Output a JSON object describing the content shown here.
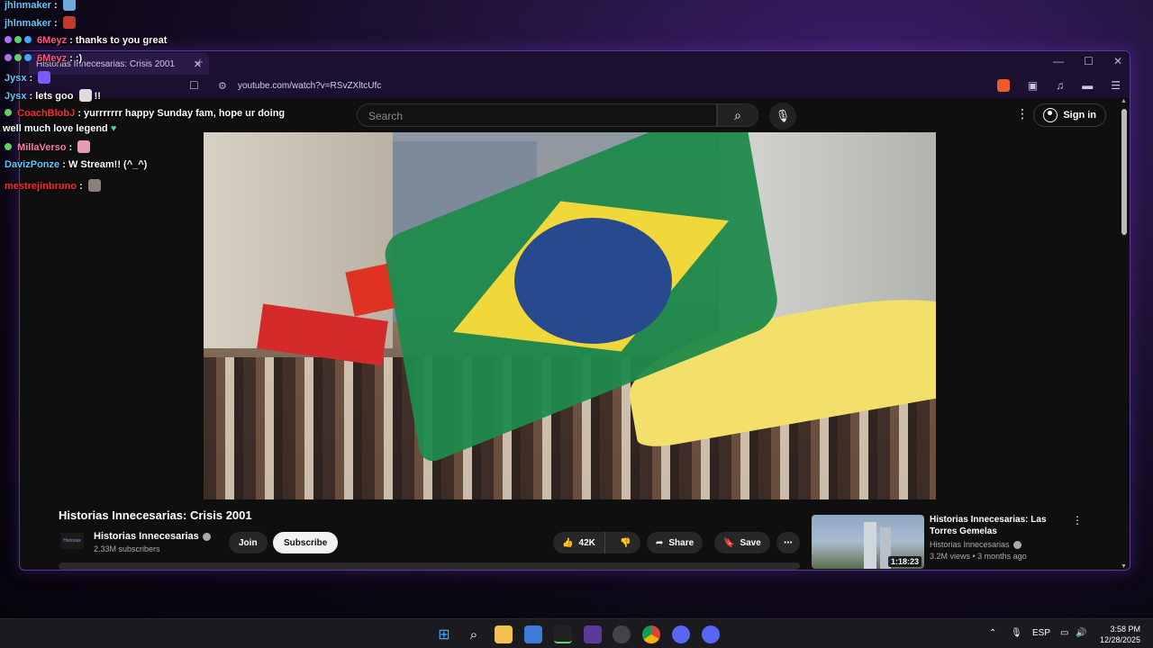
{
  "chat": {
    "messages": [
      {
        "user": "jhlnmaker",
        "text": ""
      },
      {
        "user": "jhlnmaker",
        "text": ""
      },
      {
        "user": "6Meyz",
        "text": "thanks to you great"
      },
      {
        "user": "6Meyz",
        "text": ":)"
      },
      {
        "user": "Jysx",
        "text": ""
      },
      {
        "user": "Jysx",
        "text": "lets goo"
      },
      {
        "user": "CoachBlobJ",
        "text": "yurrrrrrr happy Sunday fam, hope ur doing"
      },
      {
        "user": "",
        "text": "well much love legend"
      },
      {
        "user": "MillaVerso",
        "text": ""
      },
      {
        "user": "DavizPonze",
        "text": "W Stream!! (^_^)"
      },
      {
        "user": "mestrejinbruno",
        "text": ""
      }
    ],
    "separator": ":",
    "extra_text": "!!"
  },
  "browser": {
    "tab_title": "Historias Innecesarias: Crisis 2001",
    "url": "youtube.com/watch?v=RSvZXltcUfc"
  },
  "youtube": {
    "search_placeholder": "Search",
    "sign_in": "Sign in",
    "video_title": "Historias Innecesarias: Crisis 2001",
    "channel_name": "Historias Innecesarias",
    "channel_avatar_text": "Historias",
    "subscribers": "2.33M subscribers",
    "join": "Join",
    "subscribe": "Subscribe",
    "likes": "42K",
    "share": "Share",
    "save": "Save",
    "recommended": {
      "title": "Historias Innecesarias: Las Torres Gemelas",
      "channel": "Historias Innecesarias",
      "meta": "3.2M views • 3 months ago",
      "duration": "1:18:23"
    }
  },
  "taskbar": {
    "lang": "ESP",
    "time": "3:58 PM",
    "date": "12/28/2025"
  },
  "colors": {
    "accent_purple": "#5b3a9a",
    "brazil_green": "#1f8a4c",
    "brazil_yellow": "#f0d73a",
    "brazil_blue": "#27498e"
  }
}
